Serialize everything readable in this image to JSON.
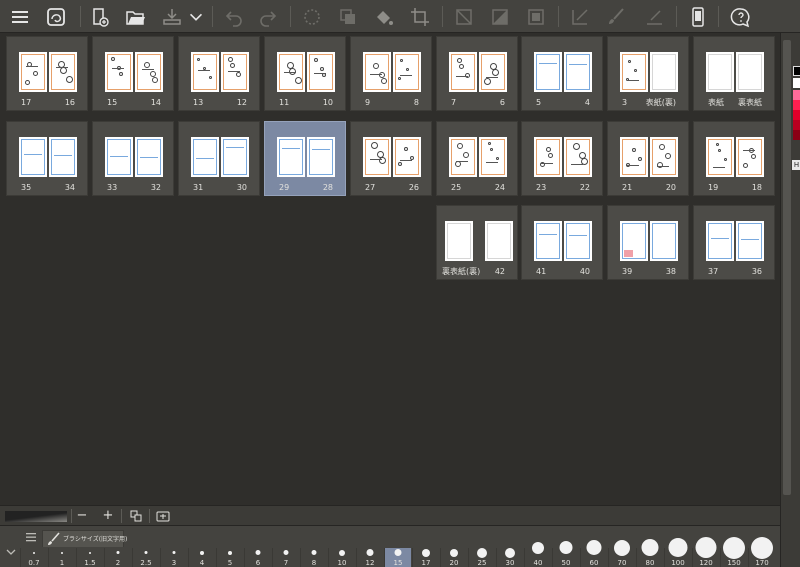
{
  "toolbar": {
    "buttons": [
      {
        "name": "menu-button",
        "icon": "hamburger-menu-icon"
      },
      {
        "name": "app-logo-button",
        "icon": "app-logo-icon"
      },
      {
        "name": "new-page-button",
        "icon": "add-page-icon"
      },
      {
        "name": "open-folder-button",
        "icon": "folder-open-icon"
      },
      {
        "name": "export-button",
        "icon": "export-tray-icon"
      },
      {
        "name": "export-dropdown-button",
        "icon": "chevron-down-icon"
      },
      {
        "name": "undo-button",
        "icon": "undo-icon"
      },
      {
        "name": "redo-button",
        "icon": "redo-icon"
      },
      {
        "name": "selection-clear-button",
        "icon": "dashed-circle-icon"
      },
      {
        "name": "copy-layer-button",
        "icon": "layers-icon"
      },
      {
        "name": "fill-button",
        "icon": "paint-bucket-icon"
      },
      {
        "name": "crop-button",
        "icon": "crop-icon"
      },
      {
        "name": "clear-outside-button",
        "icon": "slash-square-icon"
      },
      {
        "name": "fill-area-button",
        "icon": "half-square-icon"
      },
      {
        "name": "border-button",
        "icon": "bordered-square-icon"
      },
      {
        "name": "ruler-pen-button",
        "icon": "check-pen-icon"
      },
      {
        "name": "brush-tool-button",
        "icon": "brush-icon"
      },
      {
        "name": "line-tool-button",
        "icon": "line-pen-icon"
      },
      {
        "name": "smartphone-button",
        "icon": "smartphone-icon"
      },
      {
        "name": "help-button",
        "icon": "help-bubble-icon"
      }
    ]
  },
  "pages": {
    "row1": [
      {
        "left": "17",
        "right": "16",
        "style": "orange",
        "selected": false
      },
      {
        "left": "15",
        "right": "14",
        "style": "orange",
        "selected": false
      },
      {
        "left": "13",
        "right": "12",
        "style": "orange",
        "selected": false
      },
      {
        "left": "11",
        "right": "10",
        "style": "orange",
        "selected": false
      },
      {
        "left": "9",
        "right": "8",
        "style": "orange",
        "selected": false
      },
      {
        "left": "7",
        "right": "6",
        "style": "orange",
        "selected": false
      },
      {
        "left": "5",
        "right": "4",
        "style": "blue",
        "selected": false
      },
      {
        "left": "3",
        "right": "表紙(裏)",
        "style": "mixed",
        "selected": false
      },
      {
        "left": "表紙",
        "right": "裏表紙",
        "style": "plain",
        "selected": false
      }
    ],
    "row2": [
      {
        "left": "35",
        "right": "34",
        "style": "blue",
        "selected": false
      },
      {
        "left": "33",
        "right": "32",
        "style": "blue",
        "selected": false
      },
      {
        "left": "31",
        "right": "30",
        "style": "blue",
        "selected": false
      },
      {
        "left": "29",
        "right": "28",
        "style": "blue",
        "selected": true
      },
      {
        "left": "27",
        "right": "26",
        "style": "orange",
        "selected": false
      },
      {
        "left": "25",
        "right": "24",
        "style": "orange",
        "selected": false
      },
      {
        "left": "23",
        "right": "22",
        "style": "orange",
        "selected": false
      },
      {
        "left": "21",
        "right": "20",
        "style": "orange",
        "selected": false
      },
      {
        "left": "19",
        "right": "18",
        "style": "orange",
        "selected": false
      }
    ],
    "row3": [
      {
        "left": "裏表紙(裏)",
        "right": "42",
        "style": "plain-gap",
        "selected": false
      },
      {
        "left": "41",
        "right": "40",
        "style": "blue",
        "selected": false
      },
      {
        "left": "39",
        "right": "38",
        "style": "blue-red",
        "selected": false
      },
      {
        "left": "37",
        "right": "36",
        "style": "blue",
        "selected": false
      }
    ]
  },
  "bottombar": {
    "zoom_out_label": "−",
    "zoom_in_label": "+",
    "fit_icon": "fit-pages-icon",
    "page_settings_icon": "page-settings-icon"
  },
  "brush_panel": {
    "menu_icon": "hamburger-menu-icon",
    "collapse_icon": "chevron-down-icon",
    "tab_icon": "brush-size-icon",
    "tab_label": "ブラシサイズ(旧文字用)",
    "sizes": [
      "0.7",
      "1",
      "1.5",
      "2",
      "2.5",
      "3",
      "4",
      "5",
      "6",
      "7",
      "8",
      "10",
      "12",
      "15",
      "17",
      "20",
      "25",
      "30",
      "40",
      "50",
      "60",
      "70",
      "80",
      "100",
      "120",
      "150",
      "170"
    ],
    "selected_size": "15"
  },
  "colors": {
    "background": "#2f2e2b",
    "card": "#4c4b47",
    "selected_card": "#7c89a3",
    "frame_orange": "#e6a06a",
    "frame_blue": "#79a9de",
    "swatches": [
      "#000000",
      "#ffffff",
      "#ff6b9a",
      "#ff2050",
      "#e0002a",
      "#b80020",
      "#8a0015"
    ]
  }
}
